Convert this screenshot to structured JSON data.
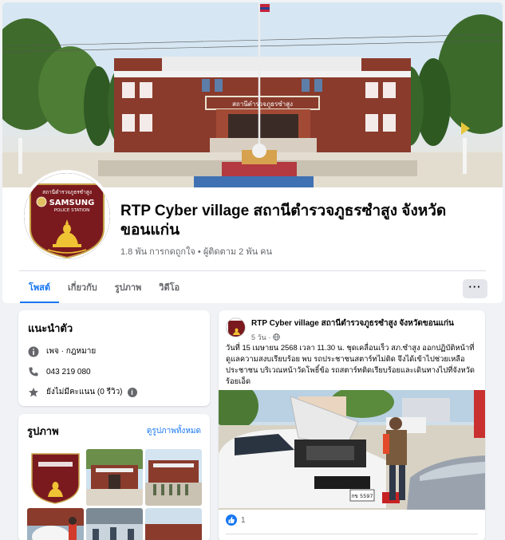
{
  "cover": {
    "building_sign": "สถานีตำรวจภูธรซำสูง"
  },
  "logo": {
    "top_text": "สถานีตำรวจภูธรซำสูง",
    "brand": "SAMSUNG",
    "sub_text": "POLICE STATION"
  },
  "page": {
    "name": "RTP Cyber village สถานีตำรวจภูธรซำสูง จังหวัดขอนแก่น",
    "stats": "1.8 พัน การกดถูกใจ • ผู้ติดตาม 2 พัน คน"
  },
  "tabs": [
    {
      "label": "โพสต์",
      "active": true
    },
    {
      "label": "เกี่ยวกับ",
      "active": false
    },
    {
      "label": "รูปภาพ",
      "active": false
    },
    {
      "label": "วิดีโอ",
      "active": false
    }
  ],
  "more_button": "···",
  "intro": {
    "title": "แนะนำตัว",
    "category": "เพจ · กฎหมาย",
    "phone": "043 219 080",
    "rating": "ยังไม่มีคะแนน (0 รีวิว)",
    "icons": [
      "info-icon",
      "phone-icon",
      "star-icon"
    ]
  },
  "photos": {
    "title": "รูปภาพ",
    "see_all": "ดูรูปภาพทั้งหมด"
  },
  "post": {
    "author": "RTP Cyber village สถานีตำรวจภูธรซำสูง จังหวัดขอนแก่น",
    "time": "5 วัน · ",
    "text": "วันที่ 15 เมษายน 2568 เวลา 11.30 น. ชุดเคลื่อนเร็ว สภ.ซำสูง ออกปฏิบัติหน้าที่ ดูแลความสงบเรียบร้อย พบ รถประชาชนสตาร์ทไม่ติด จึงได้เข้าไปช่วยเหลือประชาชน บริเวณหน้าวัดโพธิ์ข้อ รถสตาร์ทติดเรียบร้อยและเดินทางไปที่จังหวัดร้อยเอ็ด",
    "reaction_count": "1",
    "license_plate": "กข 5597"
  },
  "colors": {
    "accent": "#1877f2",
    "secondary_text": "#65676b",
    "background": "#f0f2f5"
  }
}
